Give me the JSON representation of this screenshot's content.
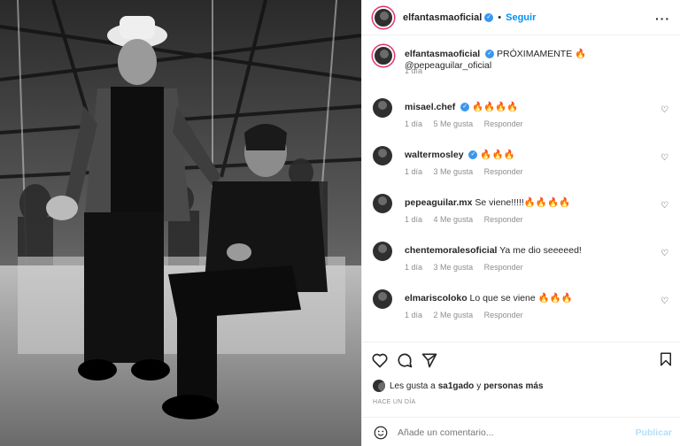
{
  "post": {
    "username": "elfantasmaoficial",
    "follow_label": "Seguir",
    "separator": "•",
    "more_label": "···",
    "caption_user": "elfantasmaoficial",
    "caption_text": "PRÓXIMAMENTE 🔥 @pepeaguilar_oficial",
    "caption_time": "1 día"
  },
  "comments": [
    {
      "user": "misael.chef",
      "verified": true,
      "text": "🔥🔥🔥🔥",
      "time": "1 día",
      "likes": "5 Me gusta",
      "reply": "Responder"
    },
    {
      "user": "waltermosley",
      "verified": true,
      "text": "🔥🔥🔥",
      "time": "1 día",
      "likes": "3 Me gusta",
      "reply": "Responder"
    },
    {
      "user": "pepeaguilar.mx",
      "verified": false,
      "text": "Se viene!!!!!🔥🔥🔥🔥",
      "time": "1 día",
      "likes": "4 Me gusta",
      "reply": "Responder"
    },
    {
      "user": "chentemoralesoficial",
      "verified": false,
      "text": "Ya me dio seeeeed!",
      "time": "1 día",
      "likes": "3 Me gusta",
      "reply": "Responder"
    },
    {
      "user": "elmariscoloko",
      "verified": false,
      "text": "Lo que se viene 🔥🔥🔥",
      "time": "1 día",
      "likes": "2 Me gusta",
      "reply": "Responder"
    }
  ],
  "likes": {
    "prefix": "Les gusta a",
    "user": "sa1gado",
    "conj": "y",
    "others": "personas más"
  },
  "time_ago": "HACE UN DÍA",
  "composer": {
    "placeholder": "Añade un comentario...",
    "publish_label": "Publicar"
  },
  "colors": {
    "accent": "#0095f6",
    "verified": "#3897f0",
    "muted": "#8e8e8e",
    "publish_disabled": "#b2dffc"
  },
  "icons": [
    "heart-icon",
    "comment-icon",
    "share-icon",
    "bookmark-icon",
    "emoji-icon",
    "verified-badge-icon",
    "more-options-icon"
  ]
}
